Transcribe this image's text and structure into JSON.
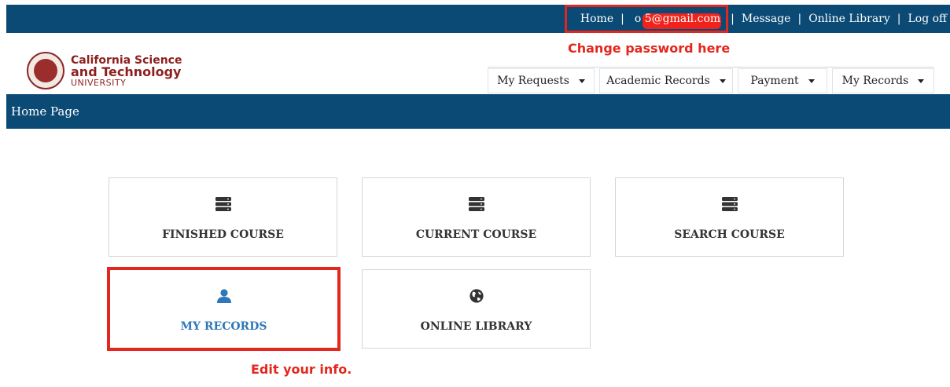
{
  "topnav": {
    "home": "Home",
    "email": "o 5@gmail.com",
    "message": "Message",
    "online_library": "Online Library",
    "logoff": "Log off",
    "separator": "|"
  },
  "logo": {
    "line1": "California Science",
    "line2": "and Technology",
    "line3": "UNIVERSITY"
  },
  "annotations": {
    "change_password": "Change password here",
    "edit_info": "Edit your info."
  },
  "menu": [
    {
      "label": "My Requests"
    },
    {
      "label": "Academic Records"
    },
    {
      "label": "Payment"
    },
    {
      "label": "My Records"
    }
  ],
  "page_title": "Home Page",
  "tiles": [
    {
      "label": "FINISHED COURSE",
      "icon": "server-icon"
    },
    {
      "label": "CURRENT COURSE",
      "icon": "server-icon"
    },
    {
      "label": "SEARCH COURSE",
      "icon": "server-icon"
    },
    {
      "label": "MY RECORDS",
      "icon": "user-icon"
    },
    {
      "label": "ONLINE LIBRARY",
      "icon": "globe-icon"
    }
  ],
  "colors": {
    "navy": "#0a4a75",
    "annotation_red": "#e3271d",
    "link_blue": "#2f78b7",
    "logo_maroon": "#8e1f1f"
  }
}
